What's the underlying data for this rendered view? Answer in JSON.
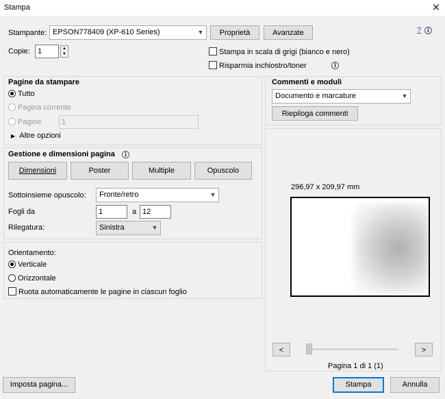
{
  "window": {
    "title": "Stampa"
  },
  "printer": {
    "label": "Stampante:",
    "selected": "EPSON778409 (XP-610 Series)",
    "properties_label": "Proprietà",
    "advanced_label": "Avanzate",
    "help_link": "?"
  },
  "copies": {
    "label": "Copie:",
    "value": "1"
  },
  "options": {
    "grayscale_label": "Stampa in scala di grigi (bianco e nero)",
    "save_ink_label": "Risparmia inchiostro/toner"
  },
  "pages": {
    "heading": "Pagine da stampare",
    "all_label": "Tutto",
    "current_label": "Pagina corrente",
    "pages_label": "Pagine",
    "pages_value": "1",
    "more_options_label": "Altre opzioni"
  },
  "sizing": {
    "heading": "Gestione e dimensioni pagina",
    "buttons": [
      "Dimensioni",
      "Poster",
      "Multiple",
      "Opuscolo"
    ],
    "subset_label": "Sottoinsieme opuscolo:",
    "subset_value": "Fronte/retro",
    "sheets_label": "Fogli da",
    "sheets_from": "1",
    "sheets_to_label": "a",
    "sheets_to": "12",
    "binding_label": "Rilegatura:",
    "binding_value": "Sinistra"
  },
  "orientation": {
    "heading": "Orientamento:",
    "portrait_label": "Verticale",
    "landscape_label": "Orizzontale",
    "auto_rotate_label": "Ruota automaticamente le pagine in ciascun foglio"
  },
  "comments": {
    "heading": "Commenti e moduli",
    "selected": "Documento e marcature",
    "summarize_label": "Riepiloga commenti"
  },
  "preview": {
    "size_text": "296,97 x 209,97 mm",
    "prev_label": "<",
    "next_label": ">",
    "page_text": "Pagina 1 di 1 (1)"
  },
  "footer": {
    "page_setup_label": "Imposta pagina...",
    "print_label": "Stampa",
    "cancel_label": "Annulla"
  },
  "colors": {
    "accent": "#0078d7",
    "dialog_bg": "#f0f0f0"
  }
}
